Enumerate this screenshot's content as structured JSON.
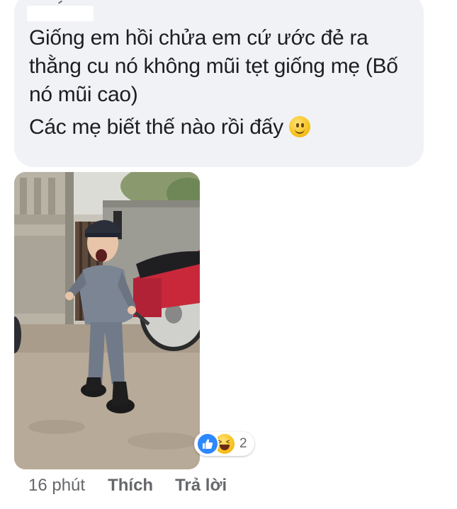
{
  "comment": {
    "text_lines": [
      "Giống em hồi chửa em cứ ước đẻ ra thằng cu nó không mũi tẹt giống mẹ (Bố nó mũi cao)",
      "Các mẹ biết thế nào rồi đấy"
    ],
    "emoji": "slightly-smiling-face-icon",
    "photo": "photo of a toddler in a denim jacket and cap crying next to a red motorbike"
  },
  "reactions": {
    "icons": [
      "like-icon",
      "haha-icon"
    ],
    "count": "2",
    "like_color": "#2d88ff"
  },
  "actions": {
    "time": "16 phút",
    "like_label": "Thích",
    "reply_label": "Trả lời"
  },
  "colors": {
    "bubble": "#f0f2f5",
    "text": "#1c1e21",
    "muted": "#65676b"
  }
}
